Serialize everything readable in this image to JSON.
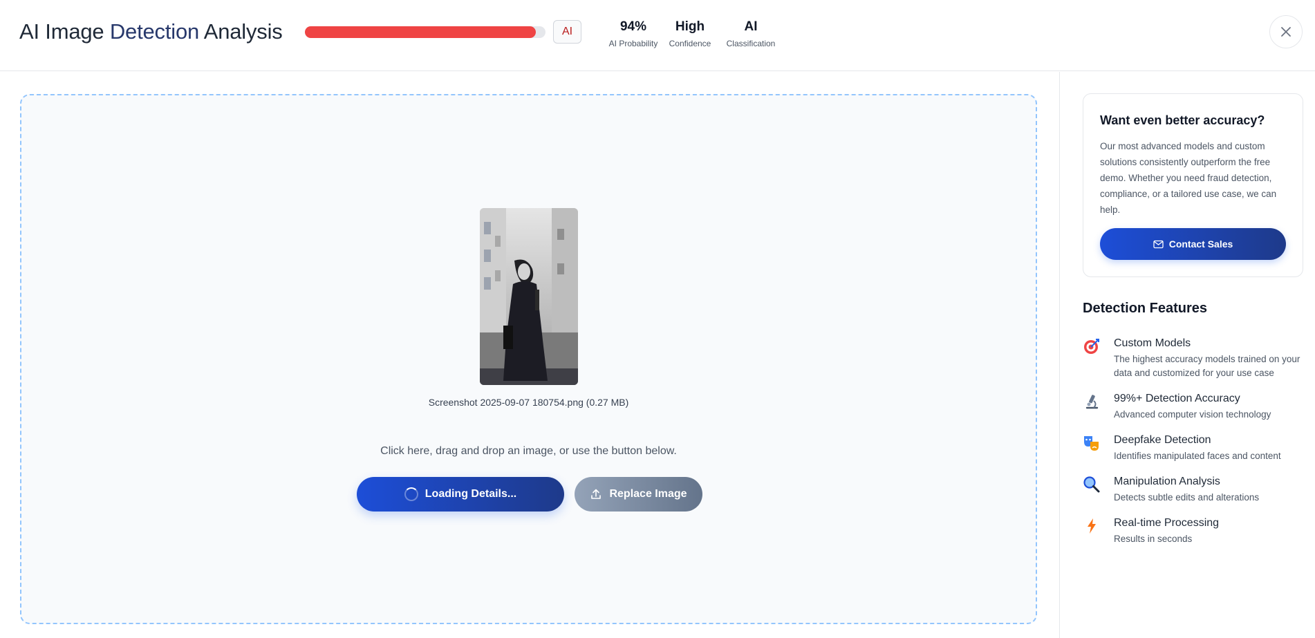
{
  "header": {
    "title_part1": "AI Image ",
    "title_part2": "Detection",
    "title_part3": " Analysis",
    "ai_probability_fill": 0.96,
    "badge": "AI",
    "stats": [
      {
        "value": "94%",
        "label": "AI Probability"
      },
      {
        "value": "High",
        "label": "Confidence"
      },
      {
        "value": "AI",
        "label": "Classification"
      }
    ],
    "close_icon": "close-icon"
  },
  "upload": {
    "filename": "Screenshot 2025-09-07 180754.png (0.27 MB)",
    "hint": "Click here, drag and drop an image, or use the button below.",
    "loading_label": "Loading Details...",
    "replace_label": "Replace Image"
  },
  "sales_card": {
    "title": "Want even better accuracy?",
    "body": "Our most advanced models and custom solutions consistently outperform the free demo. Whether you need fraud detection, compliance, or a tailored use case, we can help.",
    "button": "Contact Sales"
  },
  "features": {
    "title": "Detection Features",
    "items": [
      {
        "icon": "target-icon",
        "name": "Custom Models",
        "desc": "The highest accuracy models trained on your data and customized for your use case"
      },
      {
        "icon": "microscope-icon",
        "name": "99%+ Detection Accuracy",
        "desc": "Advanced computer vision technology"
      },
      {
        "icon": "theater-masks-icon",
        "name": "Deepfake Detection",
        "desc": "Identifies manipulated faces and content"
      },
      {
        "icon": "magnifier-icon",
        "name": "Manipulation Analysis",
        "desc": "Detects subtle edits and alterations"
      },
      {
        "icon": "lightning-icon",
        "name": "Real-time Processing",
        "desc": "Results in seconds"
      }
    ]
  },
  "colors": {
    "accent": "#1d4ed8",
    "progress": "#ef4444",
    "dropzone_border": "#93c5fd"
  }
}
